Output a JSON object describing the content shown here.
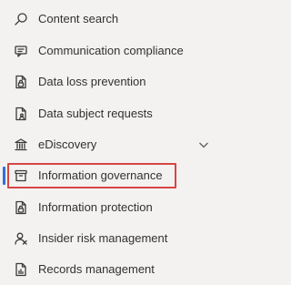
{
  "nav": {
    "items": [
      {
        "label": "Content search",
        "icon": "search-icon"
      },
      {
        "label": "Communication compliance",
        "icon": "chat-icon"
      },
      {
        "label": "Data loss prevention",
        "icon": "document-lock-icon"
      },
      {
        "label": "Data subject requests",
        "icon": "document-person-icon"
      },
      {
        "label": "eDiscovery",
        "icon": "bank-icon",
        "expandable": true
      },
      {
        "label": "Information governance",
        "icon": "archive-icon",
        "selected": true
      },
      {
        "label": "Information protection",
        "icon": "document-lock-icon"
      },
      {
        "label": "Insider risk management",
        "icon": "person-icon"
      },
      {
        "label": "Records management",
        "icon": "document-chart-icon"
      }
    ]
  },
  "colors": {
    "selected_bar": "#2f6fd6",
    "highlight_border": "#d64545",
    "background": "#f3f2f1"
  }
}
